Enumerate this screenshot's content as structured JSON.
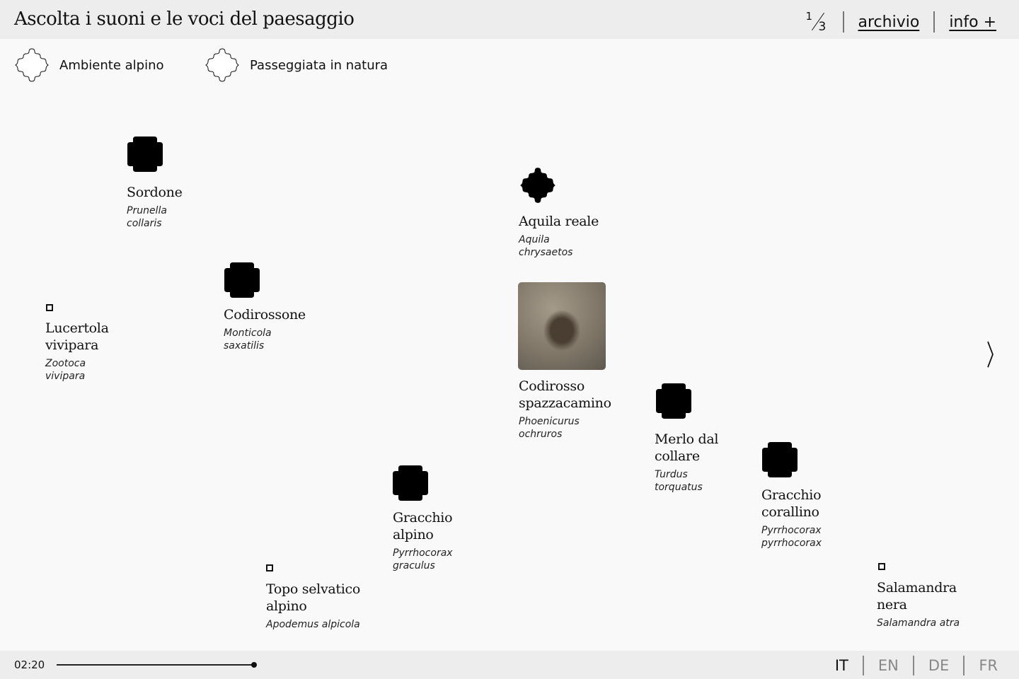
{
  "header": {
    "title": "Ascolta i suoni e le voci del paesaggio",
    "page_current": "1",
    "page_total": "3",
    "archive_link": "archivio",
    "info_link": "info +"
  },
  "legend": [
    {
      "label": "Ambiente alpino",
      "icon": "wavy-diamond-outline-icon"
    },
    {
      "label": "Passeggiata in natura",
      "icon": "wavy-diamond-outline-icon"
    }
  ],
  "items": [
    {
      "name": "Sordone",
      "latin": "Prunella collaris",
      "icon": "blob"
    },
    {
      "name": "Aquila reale",
      "latin": "Aquila chrysaetos",
      "icon": "diamond"
    },
    {
      "name": "Codirossone",
      "latin": "Monticola saxatilis",
      "icon": "blob"
    },
    {
      "name": "Lucertola vivipara",
      "latin": "Zootoca vivipara",
      "icon": "square"
    },
    {
      "name": "Codirosso spazzacamino",
      "latin": "Phoenicurus ochruros",
      "icon": "photo"
    },
    {
      "name": "Merlo dal collare",
      "latin": "Turdus torquatus",
      "icon": "blob"
    },
    {
      "name": "Gracchio corallino",
      "latin": "Pyrrhocorax pyrrhocorax",
      "icon": "blob"
    },
    {
      "name": "Gracchio alpino",
      "latin": "Pyrrhocorax graculus",
      "icon": "blob"
    },
    {
      "name": "Topo selvatico alpino",
      "latin": "Apodemus alpicola",
      "icon": "square"
    },
    {
      "name": "Salamandra nera",
      "latin": "Salamandra atra",
      "icon": "square"
    }
  ],
  "player": {
    "time": "02:20",
    "progress": 0.33
  },
  "languages": [
    {
      "code": "IT",
      "active": true
    },
    {
      "code": "EN",
      "active": false
    },
    {
      "code": "DE",
      "active": false
    },
    {
      "code": "FR",
      "active": false
    }
  ]
}
